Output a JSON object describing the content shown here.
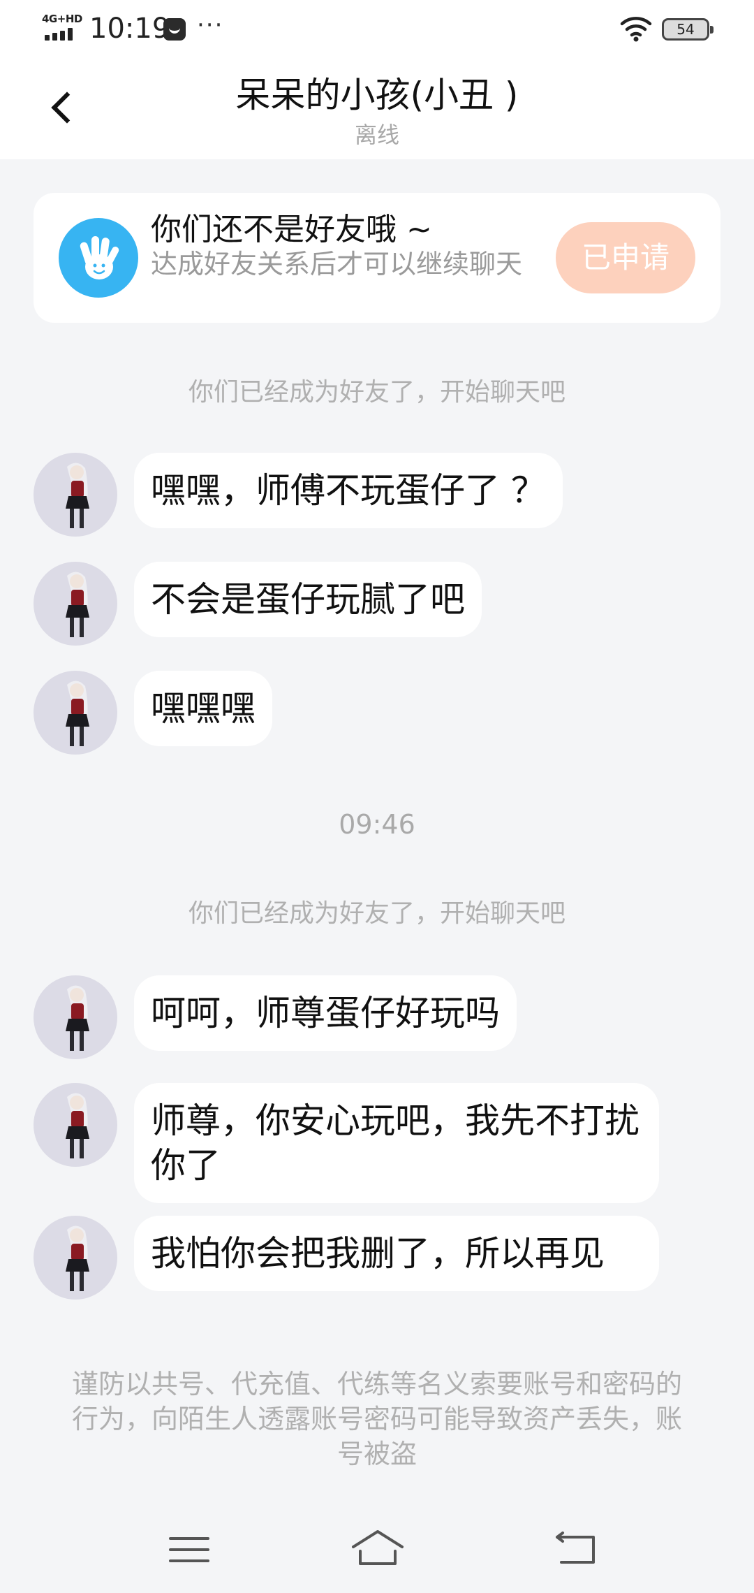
{
  "status_bar": {
    "network": "4G+HD",
    "time": "10:19",
    "more": "···",
    "battery": "54"
  },
  "header": {
    "title": "呆呆的小孩(小丑 )",
    "subtitle": "离线"
  },
  "notice": {
    "title": "你们还不是好友哦 ~",
    "desc": "达成好友关系后才可以继续聊天",
    "button_label": "已申请"
  },
  "system_notice_1": "你们已经成为好友了，开始聊天吧",
  "messages_group_1": [
    {
      "text": "嘿嘿，师傅不玩蛋仔了 ？"
    },
    {
      "text": "不会是蛋仔玩腻了吧"
    },
    {
      "text": "嘿嘿嘿"
    }
  ],
  "timestamp": "09:46",
  "system_notice_2": "你们已经成为好友了，开始聊天吧",
  "messages_group_2": [
    {
      "text": "呵呵，师尊蛋仔好玩吗"
    },
    {
      "text": "师尊，你安心玩吧，我先不打扰你了"
    },
    {
      "text": "我怕你会把我删了，所以再见"
    }
  ],
  "warning": "谨防以共号、代充值、代练等名义索要账号和密码的行为，向陌生人透露账号密码可能导致资产丢失，账号被盗",
  "nav": {
    "menu_icon": "menu-icon",
    "home_icon": "home-icon",
    "back_icon": "back-icon"
  },
  "colors": {
    "accent_blue": "#37b4f2",
    "applied_button": "#fdd1bd",
    "background": "#f4f5f7"
  }
}
